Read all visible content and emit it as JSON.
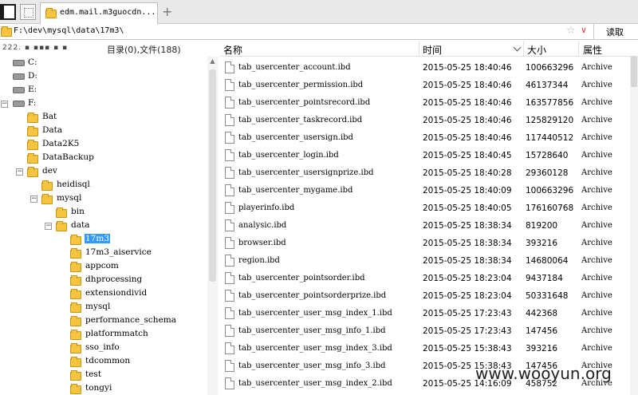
{
  "tabbar": {
    "tab_title": "edm.mail.m3guocdn...",
    "add_label": "+"
  },
  "address": {
    "path": "F:\\dev\\mysql\\data\\17m3\\",
    "fav_glyph": "☆",
    "dropdown_glyph": "∨",
    "read_label": "读取"
  },
  "left": {
    "drive_info": "222. ▪ ▪▪▪ ▪ ▪",
    "dir_count": "目录(0),文件(188)"
  },
  "tree": [
    {
      "label": "C:",
      "type": "drive",
      "depth": 0,
      "expander": ""
    },
    {
      "label": "D:",
      "type": "drive",
      "depth": 0,
      "expander": ""
    },
    {
      "label": "E:",
      "type": "drive",
      "depth": 0,
      "expander": ""
    },
    {
      "label": "F:",
      "type": "drive",
      "depth": 0,
      "expander": "−"
    },
    {
      "label": "Bat",
      "type": "folder",
      "depth": 1,
      "expander": ""
    },
    {
      "label": "Data",
      "type": "folder",
      "depth": 1,
      "expander": ""
    },
    {
      "label": "Data2K5",
      "type": "folder",
      "depth": 1,
      "expander": ""
    },
    {
      "label": "DataBackup",
      "type": "folder",
      "depth": 1,
      "expander": ""
    },
    {
      "label": "dev",
      "type": "folder",
      "depth": 1,
      "expander": "−"
    },
    {
      "label": "heidisql",
      "type": "folder",
      "depth": 2,
      "expander": ""
    },
    {
      "label": "mysql",
      "type": "folder",
      "depth": 2,
      "expander": "−"
    },
    {
      "label": "bin",
      "type": "folder",
      "depth": 3,
      "expander": ""
    },
    {
      "label": "data",
      "type": "folder",
      "depth": 3,
      "expander": "−"
    },
    {
      "label": "17m3",
      "type": "folder",
      "depth": 4,
      "expander": "",
      "selected": true
    },
    {
      "label": "17m3_aiservice",
      "type": "folder",
      "depth": 4,
      "expander": ""
    },
    {
      "label": "appcom",
      "type": "folder",
      "depth": 4,
      "expander": ""
    },
    {
      "label": "dhprocessing",
      "type": "folder",
      "depth": 4,
      "expander": ""
    },
    {
      "label": "extensiondivid",
      "type": "folder",
      "depth": 4,
      "expander": ""
    },
    {
      "label": "mysql",
      "type": "folder",
      "depth": 4,
      "expander": ""
    },
    {
      "label": "performance_schema",
      "type": "folder",
      "depth": 4,
      "expander": ""
    },
    {
      "label": "platformmatch",
      "type": "folder",
      "depth": 4,
      "expander": ""
    },
    {
      "label": "sso_info",
      "type": "folder",
      "depth": 4,
      "expander": ""
    },
    {
      "label": "tdcommon",
      "type": "folder",
      "depth": 4,
      "expander": ""
    },
    {
      "label": "test",
      "type": "folder",
      "depth": 4,
      "expander": ""
    },
    {
      "label": "tongyi",
      "type": "folder",
      "depth": 4,
      "expander": ""
    }
  ],
  "columns": {
    "name": "名称",
    "time": "时间",
    "size": "大小",
    "attr": "属性"
  },
  "files": [
    {
      "name": "tab_usercenter_account.ibd",
      "time": "2015-05-25 18:40:46",
      "size": "100663296",
      "attr": "Archive"
    },
    {
      "name": "tab_usercenter_permission.ibd",
      "time": "2015-05-25 18:40:46",
      "size": "46137344",
      "attr": "Archive"
    },
    {
      "name": "tab_usercenter_pointsrecord.ibd",
      "time": "2015-05-25 18:40:46",
      "size": "163577856",
      "attr": "Archive"
    },
    {
      "name": "tab_usercenter_taskrecord.ibd",
      "time": "2015-05-25 18:40:46",
      "size": "125829120",
      "attr": "Archive"
    },
    {
      "name": "tab_usercenter_usersign.ibd",
      "time": "2015-05-25 18:40:46",
      "size": "117440512",
      "attr": "Archive"
    },
    {
      "name": "tab_usercenter_login.ibd",
      "time": "2015-05-25 18:40:45",
      "size": "15728640",
      "attr": "Archive"
    },
    {
      "name": "tab_usercenter_usersignprize.ibd",
      "time": "2015-05-25 18:40:28",
      "size": "29360128",
      "attr": "Archive"
    },
    {
      "name": "tab_usercenter_mygame.ibd",
      "time": "2015-05-25 18:40:09",
      "size": "100663296",
      "attr": "Archive"
    },
    {
      "name": "playerinfo.ibd",
      "time": "2015-05-25 18:40:05",
      "size": "176160768",
      "attr": "Archive"
    },
    {
      "name": "analysic.ibd",
      "time": "2015-05-25 18:38:34",
      "size": "819200",
      "attr": "Archive"
    },
    {
      "name": "browser.ibd",
      "time": "2015-05-25 18:38:34",
      "size": "393216",
      "attr": "Archive"
    },
    {
      "name": "region.ibd",
      "time": "2015-05-25 18:38:34",
      "size": "14680064",
      "attr": "Archive"
    },
    {
      "name": "tab_usercenter_pointsorder.ibd",
      "time": "2015-05-25 18:23:04",
      "size": "9437184",
      "attr": "Archive"
    },
    {
      "name": "tab_usercenter_pointsorderprize.ibd",
      "time": "2015-05-25 18:23:04",
      "size": "50331648",
      "attr": "Archive"
    },
    {
      "name": "tab_usercenter_user_msg_index_1.ibd",
      "time": "2015-05-25 17:23:43",
      "size": "442368",
      "attr": "Archive"
    },
    {
      "name": "tab_usercenter_user_msg_info_1.ibd",
      "time": "2015-05-25 17:23:43",
      "size": "147456",
      "attr": "Archive"
    },
    {
      "name": "tab_usercenter_user_msg_index_3.ibd",
      "time": "2015-05-25 15:38:43",
      "size": "393216",
      "attr": "Archive"
    },
    {
      "name": "tab_usercenter_user_msg_info_3.ibd",
      "time": "2015-05-25 15:38:43",
      "size": "147456",
      "attr": "Archive"
    },
    {
      "name": "tab_usercenter_user_msg_index_2.ibd",
      "time": "2015-05-25 14:16:09",
      "size": "458752",
      "attr": "Archive"
    }
  ],
  "watermark": "www.wooyun.org"
}
